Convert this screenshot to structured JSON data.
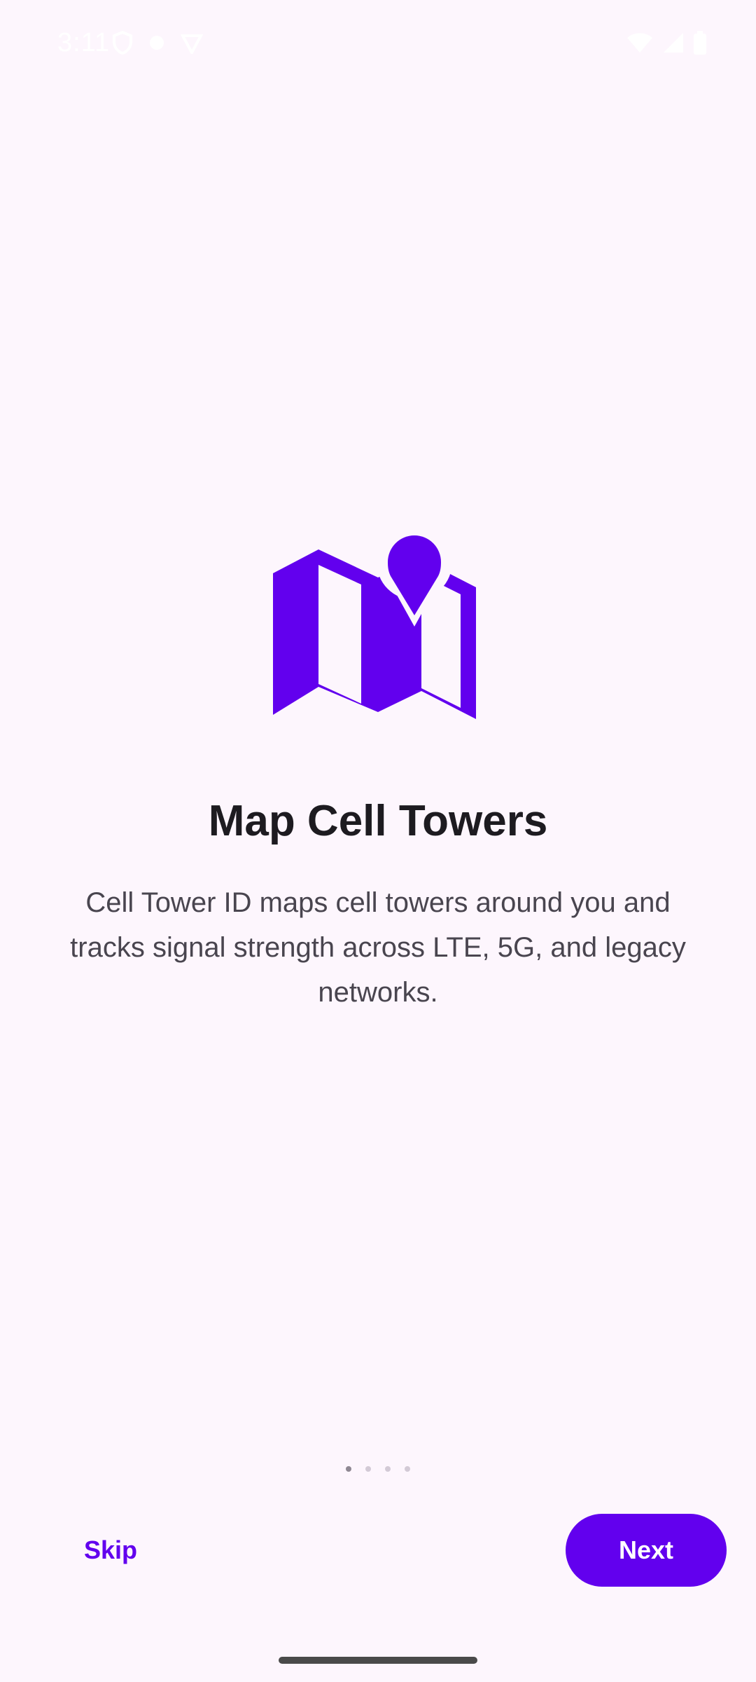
{
  "status_bar": {
    "time": "3:11",
    "left_icons": [
      "shield-icon",
      "dot-icon",
      "vpn-shield-icon"
    ],
    "right_icons": [
      "wifi-icon",
      "cell-signal-icon",
      "battery-icon"
    ]
  },
  "onboarding": {
    "icon": "map-pin-icon",
    "accent_color": "#6200EE",
    "title": "Map Cell Towers",
    "description": "Cell Tower ID maps cell towers around you and tracks signal strength across LTE, 5G, and legacy networks.",
    "page_count": 4,
    "current_page": 1
  },
  "footer": {
    "skip_label": "Skip",
    "next_label": "Next"
  }
}
